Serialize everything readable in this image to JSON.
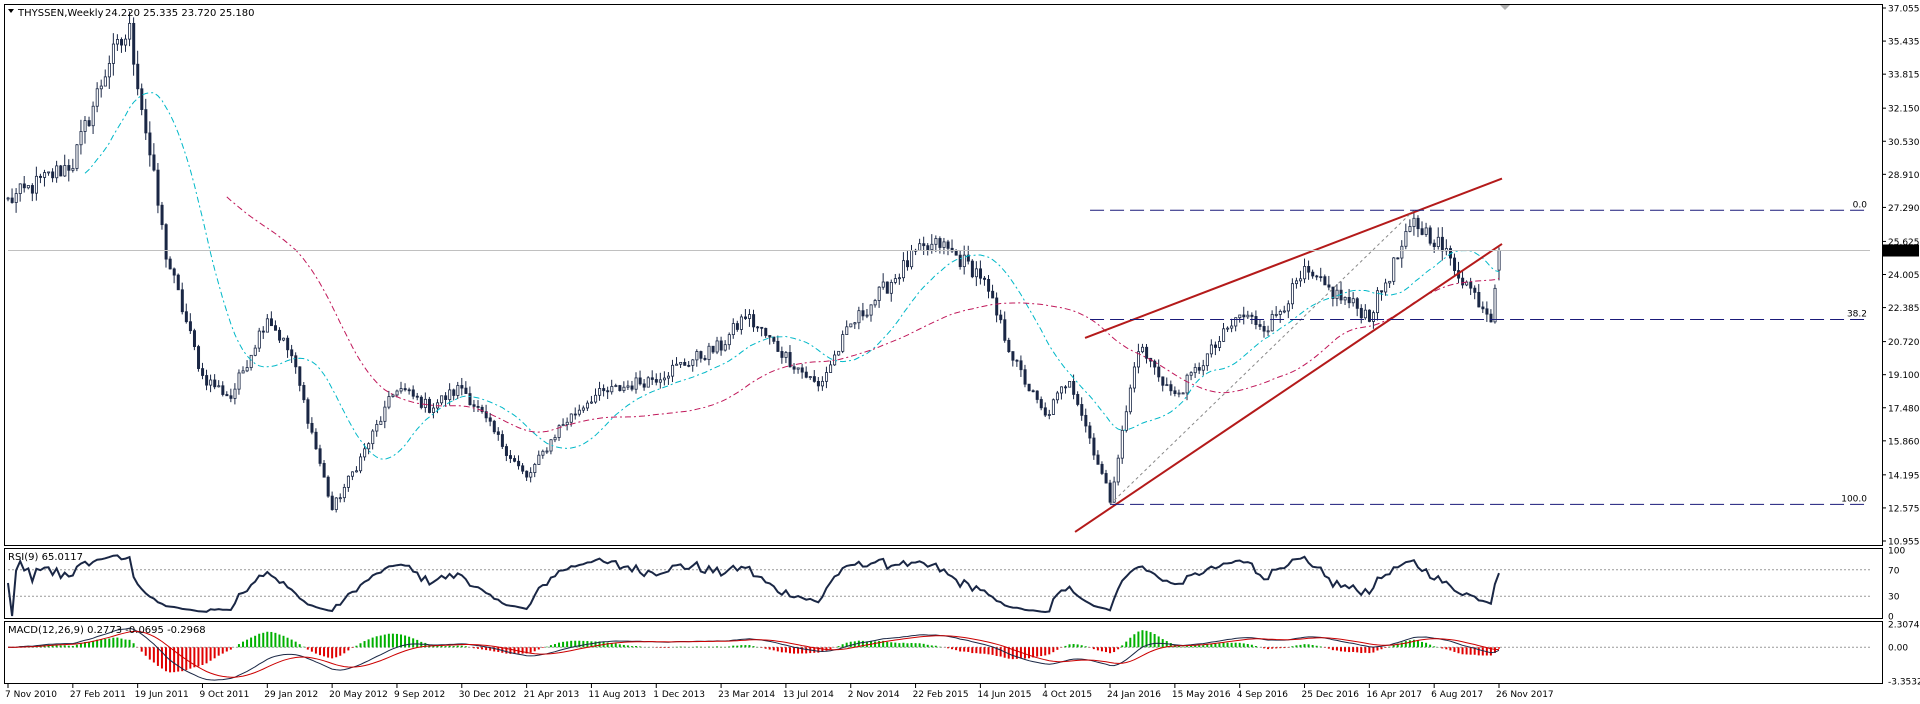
{
  "header": {
    "symbol_label": "THYSSEN,Weekly",
    "ohlc": "24.220 25.335 23.720 25.180"
  },
  "price_axis": {
    "ticks": [
      "37.055",
      "35.435",
      "33.815",
      "32.150",
      "30.530",
      "28.910",
      "27.290",
      "25.625",
      "24.005",
      "22.385",
      "20.720",
      "19.100",
      "17.480",
      "15.860",
      "14.195",
      "12.575",
      "10.955"
    ],
    "current_price": "25.180"
  },
  "fib_labels": {
    "top": "0.0",
    "mid": "38.2",
    "bottom": "100.0"
  },
  "rsi_panel": {
    "label": "RSI(9) 65.0117",
    "ticks": [
      "100",
      "70",
      "30",
      "0"
    ]
  },
  "macd_panel": {
    "label": "MACD(12,26,9) 0.2773 -0.0695 -0.2968",
    "ticks": [
      "2.3074",
      "0.00",
      "-3.3532"
    ]
  },
  "x_axis": {
    "labels": [
      "7 Nov 2010",
      "27 Feb 2011",
      "19 Jun 2011",
      "9 Oct 2011",
      "29 Jan 2012",
      "20 May 2012",
      "9 Sep 2012",
      "30 Dec 2012",
      "21 Apr 2013",
      "11 Aug 2013",
      "1 Dec 2013",
      "23 Mar 2014",
      "13 Jul 2014",
      "2 Nov 2014",
      "22 Feb 2015",
      "14 Jun 2015",
      "4 Oct 2015",
      "24 Jan 2016",
      "15 May 2016",
      "4 Sep 2016",
      "25 Dec 2016",
      "16 Apr 2017",
      "6 Aug 2017",
      "26 Nov 2017"
    ]
  },
  "colors": {
    "candle": "#1a2745",
    "ma_fast": "#00b8c8",
    "ma_slow": "#c0185a",
    "channel": "#b41a1a",
    "fib": "#1a1a7a",
    "rsi": "#1a2745",
    "macd_pos": "#00b000",
    "macd_neg": "#e00000",
    "macd_line": "#1a2745",
    "signal_line": "#cc0000"
  },
  "chart_data": {
    "type": "candlestick",
    "title": "THYSSEN,Weekly",
    "timeframe": "Weekly",
    "last_bar": {
      "open": 24.22,
      "high": 25.335,
      "low": 23.72,
      "close": 25.18
    },
    "ylim": [
      10.955,
      37.055
    ],
    "x_range": [
      "7 Nov 2010",
      "26 Nov 2017"
    ],
    "close_path": [
      {
        "date": "7 Nov 2010",
        "close": 27.6
      },
      {
        "date": "27 Feb 2011",
        "close": 29.5
      },
      {
        "date": "1 May 2011",
        "close": 34.5
      },
      {
        "date": "5 Jun 2011",
        "close": 35.9
      },
      {
        "date": "19 Jun 2011",
        "close": 33.5
      },
      {
        "date": "7 Aug 2011",
        "close": 25.0
      },
      {
        "date": "9 Oct 2011",
        "close": 19.0
      },
      {
        "date": "27 Nov 2011",
        "close": 18.0
      },
      {
        "date": "29 Jan 2012",
        "close": 22.0
      },
      {
        "date": "11 Mar 2012",
        "close": 20.0
      },
      {
        "date": "20 May 2012",
        "close": 12.5
      },
      {
        "date": "8 Jul 2012",
        "close": 15.0
      },
      {
        "date": "9 Sep 2012",
        "close": 18.5
      },
      {
        "date": "4 Nov 2012",
        "close": 17.5
      },
      {
        "date": "30 Dec 2012",
        "close": 18.5
      },
      {
        "date": "21 Apr 2013",
        "close": 14.0
      },
      {
        "date": "16 Jun 2013",
        "close": 16.5
      },
      {
        "date": "11 Aug 2013",
        "close": 18.0
      },
      {
        "date": "1 Dec 2013",
        "close": 19.0
      },
      {
        "date": "23 Mar 2014",
        "close": 20.5
      },
      {
        "date": "4 May 2014",
        "close": 22.0
      },
      {
        "date": "13 Jul 2014",
        "close": 20.0
      },
      {
        "date": "7 Sep 2014",
        "close": 18.5
      },
      {
        "date": "2 Nov 2014",
        "close": 21.5
      },
      {
        "date": "22 Feb 2015",
        "close": 25.0
      },
      {
        "date": "5 Apr 2015",
        "close": 25.5
      },
      {
        "date": "14 Jun 2015",
        "close": 24.0
      },
      {
        "date": "16 Aug 2015",
        "close": 19.5
      },
      {
        "date": "4 Oct 2015",
        "close": 17.0
      },
      {
        "date": "15 Nov 2015",
        "close": 19.0
      },
      {
        "date": "24 Jan 2016",
        "close": 13.0
      },
      {
        "date": "13 Mar 2016",
        "close": 20.5
      },
      {
        "date": "15 May 2016",
        "close": 18.0
      },
      {
        "date": "4 Sep 2016",
        "close": 22.0
      },
      {
        "date": "23 Oct 2016",
        "close": 21.5
      },
      {
        "date": "25 Dec 2016",
        "close": 24.0
      },
      {
        "date": "16 Apr 2017",
        "close": 22.0
      },
      {
        "date": "2 Jul 2017",
        "close": 26.5
      },
      {
        "date": "6 Aug 2017",
        "close": 25.8
      },
      {
        "date": "15 Oct 2017",
        "close": 23.0
      },
      {
        "date": "12 Nov 2017",
        "close": 22.0
      },
      {
        "date": "26 Nov 2017",
        "close": 25.18
      }
    ],
    "fibonacci": [
      {
        "level": "0.0",
        "price": 27.15
      },
      {
        "level": "38.2",
        "price": 21.8
      },
      {
        "level": "100.0",
        "price": 12.75
      }
    ],
    "rsi": {
      "period": 9,
      "value": 65.0117,
      "levels": [
        70,
        30
      ],
      "ylim": [
        0,
        100
      ]
    },
    "macd": {
      "fast": 12,
      "slow": 26,
      "signal": 9,
      "values": [
        0.2773,
        -0.0695,
        -0.2968
      ],
      "ylim": [
        -3.3532,
        2.3074
      ]
    }
  }
}
